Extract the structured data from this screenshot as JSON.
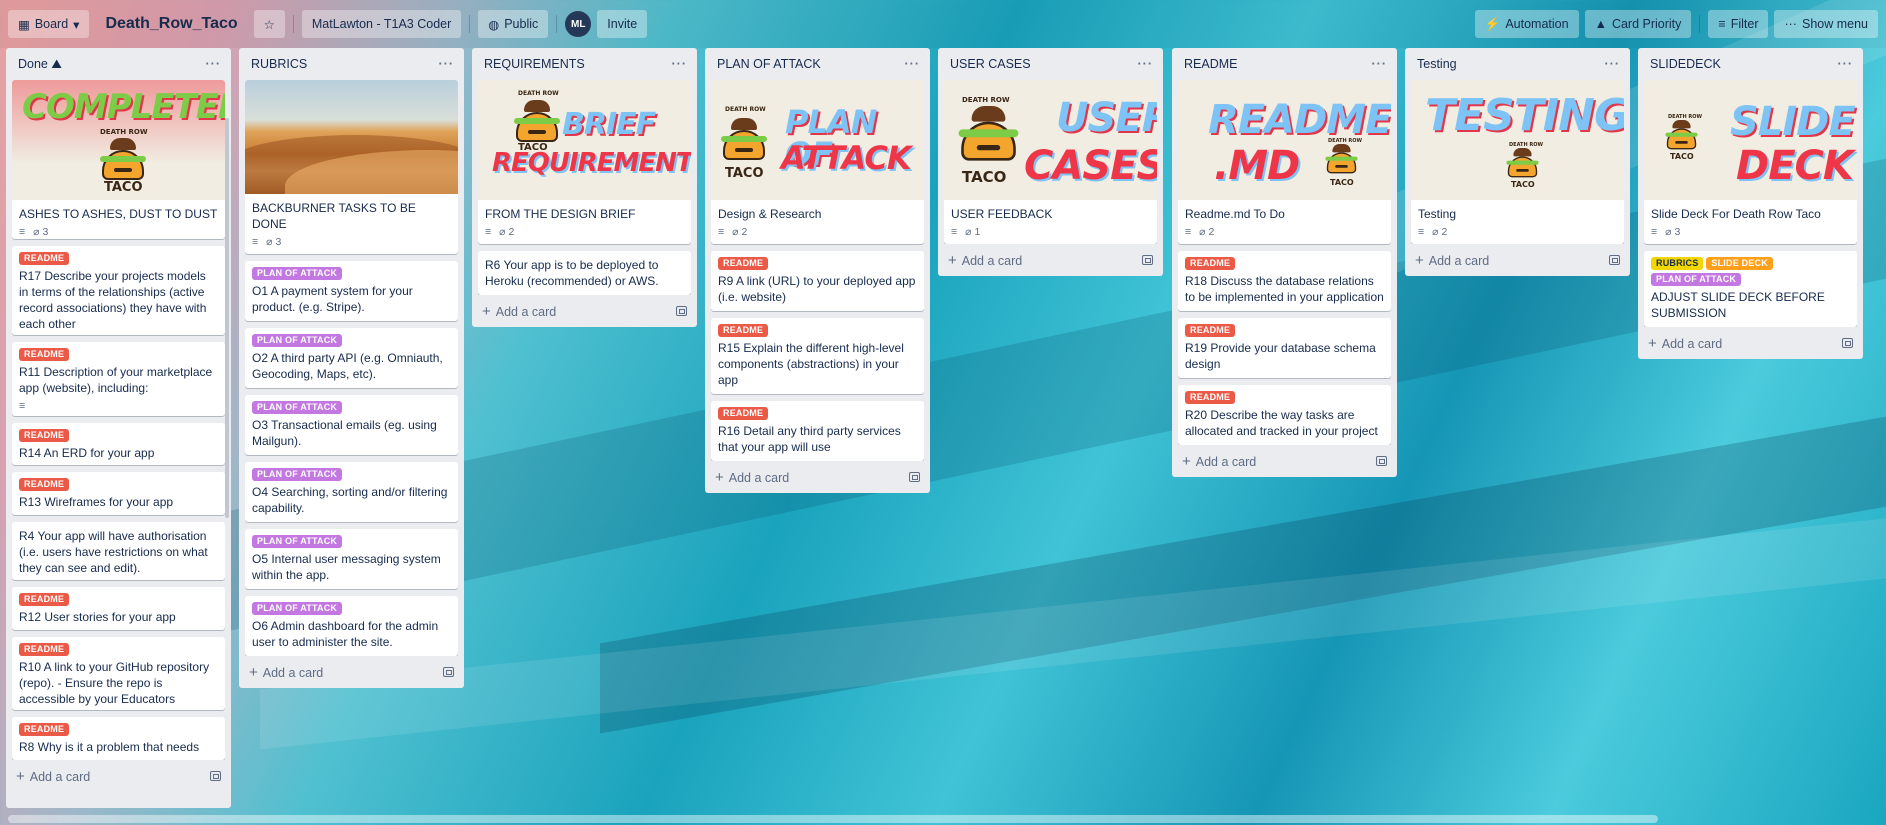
{
  "header": {
    "view_label": "Board",
    "board_title": "Death_Row_Taco",
    "workspace": "MatLawton - T1A3 Coder",
    "visibility": "Public",
    "avatar_initials": "ML",
    "invite": "Invite",
    "automation": "Automation",
    "card_priority": "Card Priority",
    "filter": "Filter",
    "show_menu": "Show menu"
  },
  "add_card_label": "Add a card",
  "lists": [
    {
      "title": "Done",
      "cover_text": [
        "COMPLETED",
        "DEATH ROW",
        "TACO"
      ],
      "cover_card_title": "ASHES TO ASHES, DUST TO DUST",
      "cover_card_attachments": "3",
      "cards": [
        {
          "label": "README",
          "title": "R17 Describe your projects models in terms of the relationships (active record associations) they have with each other"
        },
        {
          "label": "README",
          "title": "R11 Description of your marketplace app (website), including:"
        },
        {
          "label": "README",
          "title": "R14 An ERD for your app"
        },
        {
          "label": "README",
          "title": "R13 Wireframes for your app"
        },
        {
          "label": "",
          "title": "R4 Your app will have authorisation (i.e. users have restrictions on what they can see and edit)."
        },
        {
          "label": "README",
          "title": "R12 User stories for your app"
        },
        {
          "label": "README",
          "title": "R10 A link to your GitHub repository (repo). - Ensure the repo is accessible by your Educators"
        },
        {
          "label": "README",
          "title": "R8 Why is it a problem that needs"
        }
      ]
    },
    {
      "title": "RUBRICS",
      "cover_card_title": "BACKBURNER TASKS TO BE DONE",
      "cover_card_attachments": "3",
      "cards": [
        {
          "label": "PLAN OF ATTACK",
          "title": "O1 A payment system for your product. (e.g. Stripe)."
        },
        {
          "label": "PLAN OF ATTACK",
          "title": "O2 A third party API (e.g. Omniauth, Geocoding, Maps, etc)."
        },
        {
          "label": "PLAN OF ATTACK",
          "title": "O3 Transactional emails (eg. using Mailgun)."
        },
        {
          "label": "PLAN OF ATTACK",
          "title": "O4 Searching, sorting and/or filtering capability."
        },
        {
          "label": "PLAN OF ATTACK",
          "title": "O5 Internal user messaging system within the app."
        },
        {
          "label": "PLAN OF ATTACK",
          "title": "O6 Admin dashboard for the admin user to administer the site."
        }
      ]
    },
    {
      "title": "REQUIREMENTS",
      "cover_text": [
        "BRIEF",
        "REQUIREMENTS",
        "DEATH ROW",
        "TACO"
      ],
      "cover_card_title": "FROM THE DESIGN BRIEF",
      "cover_card_attachments": "2",
      "cards": [
        {
          "label": "",
          "title": "R6 Your app is to be deployed to Heroku (recommended) or AWS."
        }
      ]
    },
    {
      "title": "PLAN OF ATTACK",
      "cover_text": [
        "PLAN OF",
        "ATTACK",
        "DEATH ROW",
        "TACO"
      ],
      "cover_card_title": "Design & Research",
      "cover_card_attachments": "2",
      "cards": [
        {
          "label": "README",
          "title": "R9 A link (URL) to your deployed app (i.e. website)"
        },
        {
          "label": "README",
          "title": "R15 Explain the different high-level components (abstractions) in your app"
        },
        {
          "label": "README",
          "title": "R16 Detail any third party services that your app will use"
        }
      ]
    },
    {
      "title": "USER CASES",
      "cover_text": [
        "USER",
        "CASES",
        "DEATH ROW",
        "TACO"
      ],
      "cover_card_title": "USER FEEDBACK",
      "cover_card_attachments": "1",
      "cards": []
    },
    {
      "title": "README",
      "cover_text": [
        "README",
        ".MD",
        "DEATH ROW",
        "TACO"
      ],
      "cover_card_title": "Readme.md To Do",
      "cover_card_attachments": "2",
      "cards": [
        {
          "label": "README",
          "title": "R18 Discuss the database relations to be implemented in your application"
        },
        {
          "label": "README",
          "title": "R19 Provide your database schema design"
        },
        {
          "label": "README",
          "title": "R20 Describe the way tasks are allocated and tracked in your project"
        }
      ]
    },
    {
      "title": "Testing",
      "cover_text": [
        "TESTING",
        "DEATH ROW",
        "TACO"
      ],
      "cover_card_title": "Testing",
      "cover_card_attachments": "2",
      "cards": []
    },
    {
      "title": "SLIDEDECK",
      "cover_text": [
        "SLIDE",
        "DECK",
        "DEATH ROW",
        "TACO"
      ],
      "cover_card_title": "Slide Deck For Death Row Taco",
      "cover_card_attachments": "3",
      "cards": [
        {
          "labels": [
            "RUBRICS",
            "SLIDE DECK",
            "PLAN OF ATTACK"
          ],
          "title": "ADJUST SLIDE DECK BEFORE SUBMISSION"
        }
      ]
    }
  ],
  "colors": {
    "readme_label": "#eb5a46",
    "plan_label": "#c377e0",
    "rubrics_label": "#f2d600",
    "slide_label": "#ff9f1a",
    "list_bg": "#ebecf0"
  }
}
